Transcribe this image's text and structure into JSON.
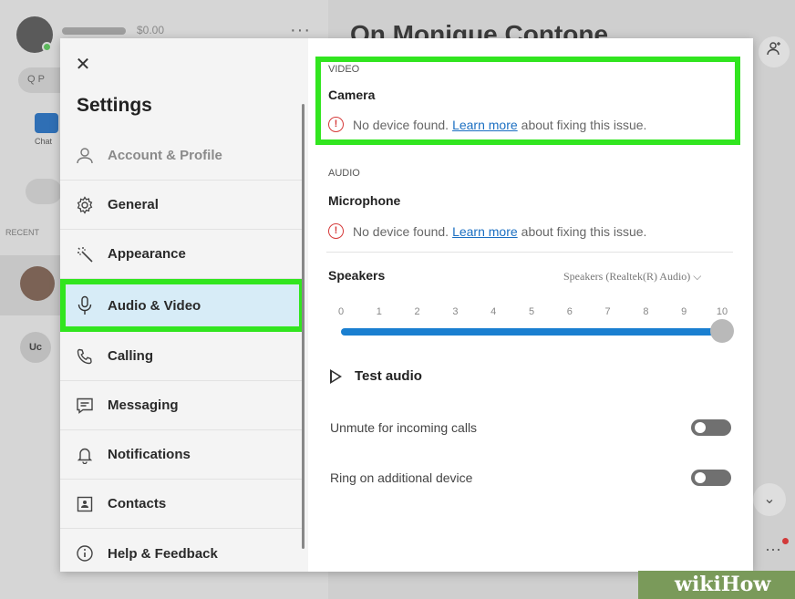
{
  "background": {
    "credit": "$0.00",
    "search_placeholder": "Q P",
    "chat_label": "Chat",
    "recent_label": "RECENT",
    "contact_initials": "Uc",
    "conversation_title": "On Monique Contone"
  },
  "settings": {
    "title": "Settings",
    "nav": [
      {
        "label": "Account & Profile",
        "icon": "person-icon"
      },
      {
        "label": "General",
        "icon": "gear-icon"
      },
      {
        "label": "Appearance",
        "icon": "wand-icon"
      },
      {
        "label": "Audio & Video",
        "icon": "microphone-icon",
        "active": true
      },
      {
        "label": "Calling",
        "icon": "phone-icon"
      },
      {
        "label": "Messaging",
        "icon": "message-icon"
      },
      {
        "label": "Notifications",
        "icon": "bell-icon"
      },
      {
        "label": "Contacts",
        "icon": "contact-card-icon"
      },
      {
        "label": "Help & Feedback",
        "icon": "info-icon"
      }
    ]
  },
  "video": {
    "section": "VIDEO",
    "device": "Camera",
    "warning_before": "No device found.",
    "warning_link": "Learn more",
    "warning_after": "about fixing this issue."
  },
  "audio": {
    "section": "AUDIO",
    "device": "Microphone",
    "warning_before": "No device found.",
    "warning_link": "Learn more",
    "warning_after": "about fixing this issue.",
    "speakers_label": "Speakers",
    "speakers_device": "Speakers (Realtek(R) Audio)",
    "volume_ticks": [
      "0",
      "1",
      "2",
      "3",
      "4",
      "5",
      "6",
      "7",
      "8",
      "9",
      "10"
    ],
    "volume_level": 10,
    "test_audio": "Test audio",
    "unmute_label": "Unmute for incoming calls",
    "unmute_on": false,
    "ring_label": "Ring on additional device",
    "ring_on": false
  },
  "watermark": "wikiHow",
  "colors": {
    "highlight": "#31e51f",
    "accent": "#1a7fd0",
    "warning": "#d63b3b",
    "active_nav": "#d7ecf7"
  }
}
